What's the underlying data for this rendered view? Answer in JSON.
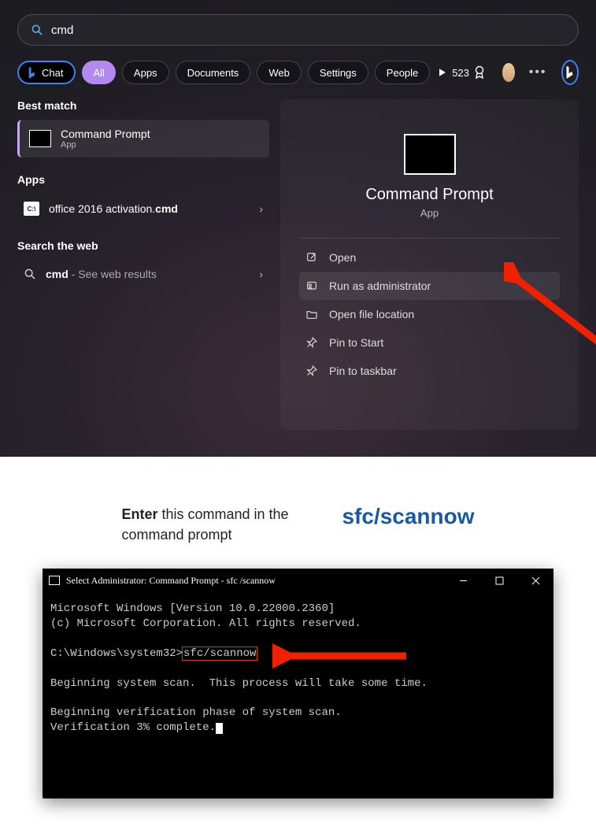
{
  "search": {
    "value": "cmd",
    "placeholder": ""
  },
  "chips": {
    "chat": "Chat",
    "all": "All",
    "apps": "Apps",
    "documents": "Documents",
    "web": "Web",
    "settings": "Settings",
    "people": "People"
  },
  "points": "523",
  "left": {
    "bestmatch_title": "Best match",
    "bestmatch": {
      "label": "Command Prompt",
      "sub": "App"
    },
    "apps_title": "Apps",
    "apps_item": {
      "prefix": "office 2016 activation.",
      "bold": "cmd"
    },
    "web_title": "Search the web",
    "web_item": {
      "bold": "cmd",
      "suffix": " - See web results"
    }
  },
  "right": {
    "title": "Command Prompt",
    "sub": "App",
    "actions": {
      "open": "Open",
      "runas": "Run as administrator",
      "openloc": "Open file location",
      "pin_start": "Pin to Start",
      "pin_taskbar": "Pin to taskbar"
    }
  },
  "instruction": {
    "bold": "Enter",
    "rest": " this command in the command prompt",
    "command": "sfc/scannow"
  },
  "cmd": {
    "title": "Select Administrator: Command Prompt - sfc /scannow",
    "line1": "Microsoft Windows [Version 10.0.22000.2360]",
    "line2": "(c) Microsoft Corporation. All rights reserved.",
    "prompt": "C:\\Windows\\system32>",
    "typed": "sfc/scannow",
    "line4": "Beginning system scan.  This process will take some time.",
    "line5": "Beginning verification phase of system scan.",
    "line6": "Verification 3% complete."
  }
}
